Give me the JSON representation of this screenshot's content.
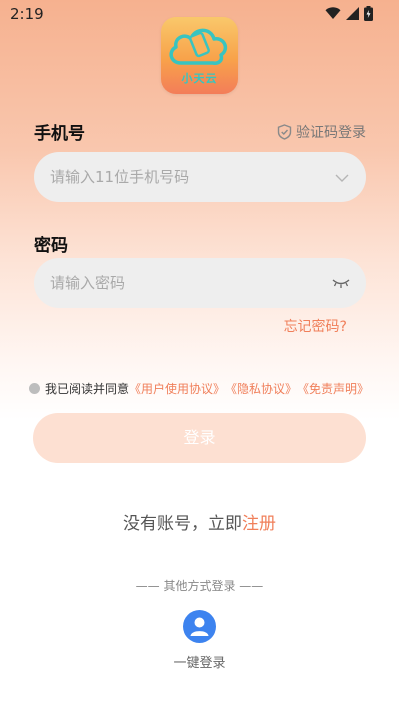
{
  "status_bar": {
    "time": "2:19"
  },
  "logo": {
    "text": "小天云"
  },
  "phone": {
    "label": "手机号",
    "placeholder": "请输入11位手机号码"
  },
  "sms_login": {
    "label": "验证码登录"
  },
  "password": {
    "label": "密码",
    "placeholder": "请输入密码"
  },
  "forgot": {
    "label": "忘记密码?"
  },
  "agreement": {
    "prefix": "我已阅读并同意",
    "user_agreement": "《用户使用协议》",
    "privacy": "《隐私协议》",
    "disclaimer": "《免责声明》"
  },
  "login_button": {
    "label": "登录"
  },
  "register": {
    "prefix": "没有账号，立即",
    "link": "注册"
  },
  "other_login": {
    "label": "—— 其他方式登录 ——"
  },
  "one_key": {
    "label": "一键登录",
    "icon": "user-icon"
  },
  "colors": {
    "accent": "#f07f5a",
    "button_disabled": "#fde0d2",
    "one_key_blue": "#3d83ef"
  }
}
